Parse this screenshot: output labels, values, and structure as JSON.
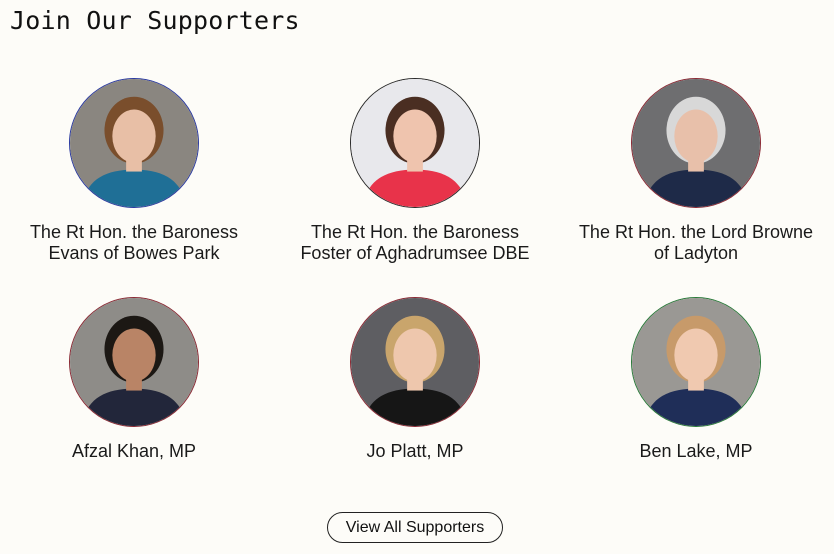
{
  "section": {
    "title": "Join Our Supporters"
  },
  "supporters": [
    {
      "line1": "The Rt Hon. the Baroness",
      "line2": "Evans of Bowes Park",
      "ring_color": "#2b3aa0",
      "bg": "#8a8680",
      "skin": "#e8bfa6",
      "hair": "#7a4e2c",
      "clothing": "#1f6f96",
      "icon": "portrait-photo"
    },
    {
      "line1": "The Rt Hon. the Baroness",
      "line2": "Foster of Aghadrumsee DBE",
      "ring_color": "#2a2a2a",
      "bg": "#e8e8ec",
      "skin": "#efc4ae",
      "hair": "#4a2e22",
      "clothing": "#e8334a",
      "icon": "portrait-photo"
    },
    {
      "line1": "The Rt Hon. the Lord Browne",
      "line2": "of Ladyton",
      "ring_color": "#8a2a35",
      "bg": "#6e6e70",
      "skin": "#e8c0aa",
      "hair": "#d8d8d8",
      "clothing": "#1e2a48",
      "icon": "portrait-photo"
    },
    {
      "line1": "Afzal Khan, MP",
      "line2": "",
      "ring_color": "#8a2a35",
      "bg": "#8e8c88",
      "skin": "#b98466",
      "hair": "#1c1814",
      "clothing": "#22263a",
      "icon": "portrait-photo"
    },
    {
      "line1": "Jo Platt, MP",
      "line2": "",
      "ring_color": "#8a2a35",
      "bg": "#5e5e62",
      "skin": "#eec7ad",
      "hair": "#c9a56c",
      "clothing": "#161616",
      "icon": "portrait-photo"
    },
    {
      "line1": "Ben Lake, MP",
      "line2": "",
      "ring_color": "#2a7a3a",
      "bg": "#9a9894",
      "skin": "#f0c9b0",
      "hair": "#c79a6a",
      "clothing": "#1f2e58",
      "icon": "portrait-photo"
    }
  ],
  "actions": {
    "view_all_label": "View All Supporters"
  }
}
